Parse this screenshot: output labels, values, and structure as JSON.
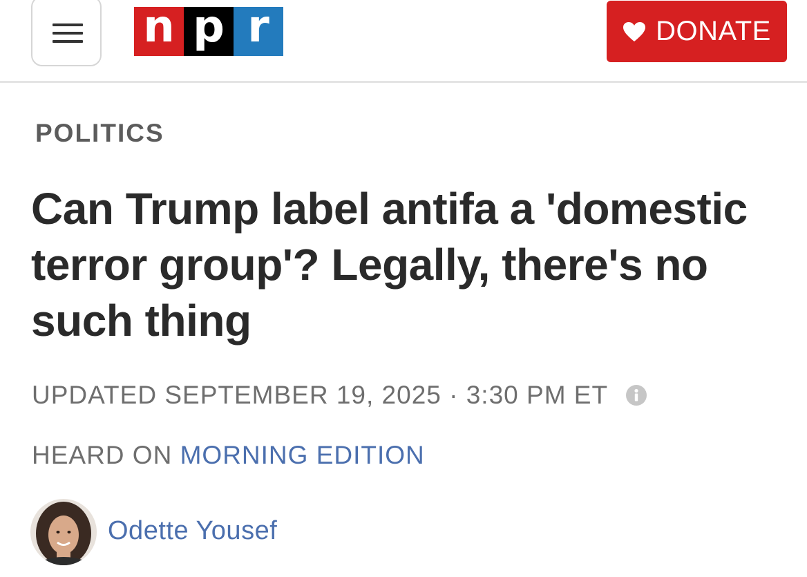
{
  "header": {
    "menu_icon": "hamburger-menu-icon",
    "logo": {
      "letters": [
        "n",
        "p",
        "r"
      ],
      "colors": [
        "#d62021",
        "#000000",
        "#237bbd"
      ]
    },
    "donate_label": "DONATE",
    "donate_icon": "heart-icon",
    "accent_color": "#d62021"
  },
  "article": {
    "category": "POLITICS",
    "headline": "Can Trump label antifa a 'domestic terror group'? Legally, there's no such thing",
    "updated": "UPDATED SEPTEMBER 19, 2025 · 3:30 PM ET",
    "info_icon": "info-icon",
    "heard_on_prefix": "HEARD ON",
    "heard_on_program": "MORNING EDITION",
    "author": "Odette Yousef",
    "link_color": "#4b6fae"
  }
}
